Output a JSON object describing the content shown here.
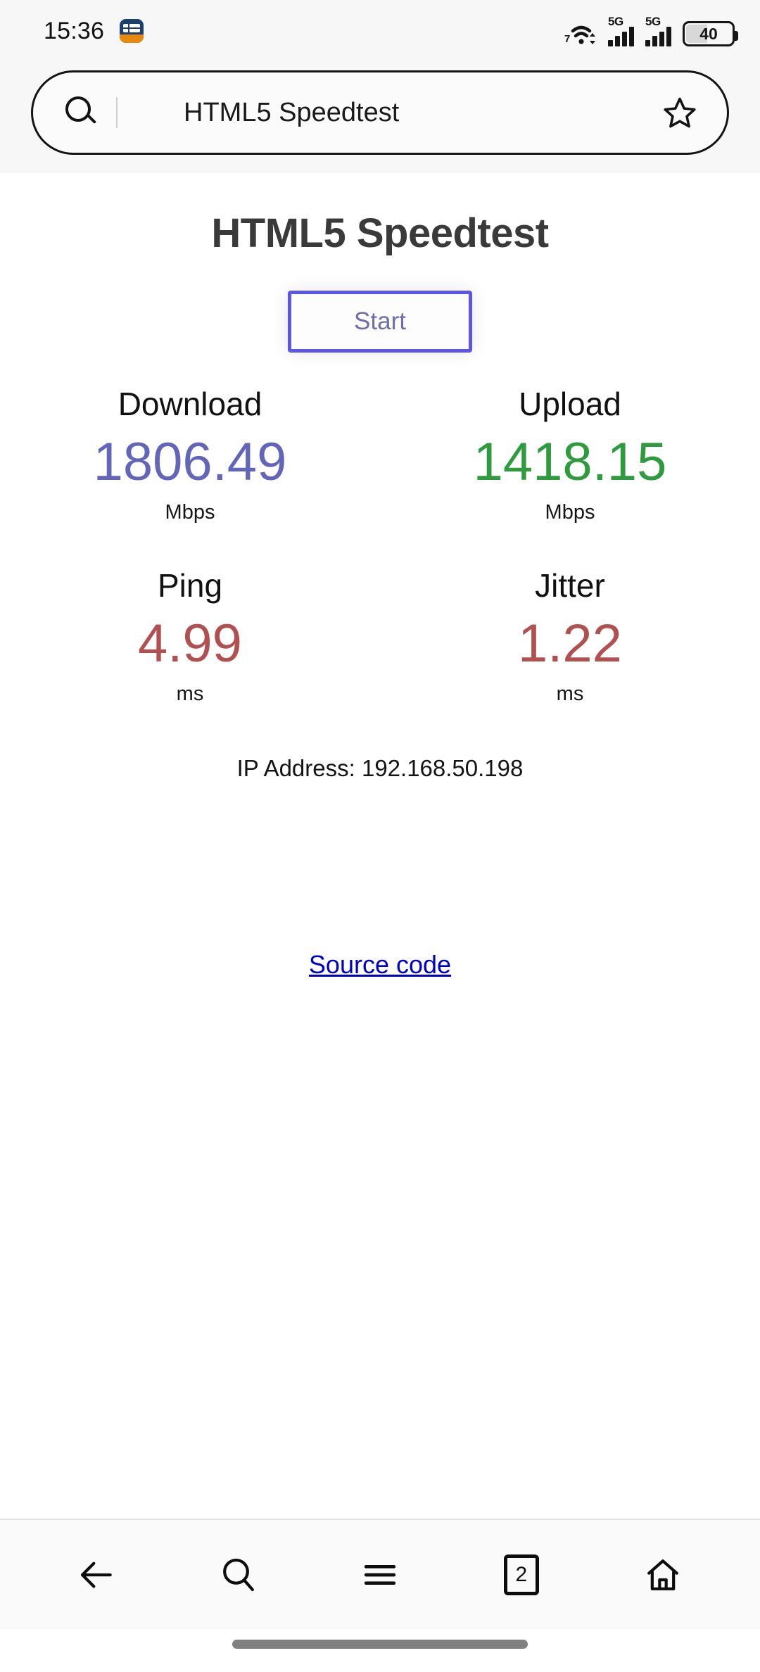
{
  "statusbar": {
    "time": "15:36",
    "app_icon": "calendar-app-icon",
    "wifi_icon": "wifi-7-icon",
    "wifi_generation": "7",
    "signal1": {
      "icon": "signal-5g-icon",
      "label": "5G"
    },
    "signal2": {
      "icon": "signal-5g-icon",
      "label": "5G"
    },
    "battery": {
      "icon": "battery-icon",
      "level": "40"
    }
  },
  "browser": {
    "search_icon": "search-icon",
    "security_icon": "shield-warning-icon",
    "url_text": "HTML5 Speedtest",
    "bookmark_icon": "star-outline-icon"
  },
  "page": {
    "title": "HTML5 Speedtest",
    "start_button": "Start",
    "metrics": [
      {
        "label": "Download",
        "value": "1806.49",
        "unit": "Mbps",
        "color": "#6366b8"
      },
      {
        "label": "Upload",
        "value": "1418.15",
        "unit": "Mbps",
        "color": "#2e9b3f"
      },
      {
        "label": "Ping",
        "value": "4.99",
        "unit": "ms",
        "color": "#b05050"
      },
      {
        "label": "Jitter",
        "value": "1.22",
        "unit": "ms",
        "color": "#b05050"
      }
    ],
    "ip_address": "IP Address: 192.168.50.198",
    "source_code_link": "Source code"
  },
  "navbar": {
    "back_icon": "back-arrow-icon",
    "search_icon": "search-icon",
    "menu_icon": "hamburger-menu-icon",
    "tabs_icon": "tab-switcher-icon",
    "tab_count": "2",
    "home_icon": "home-icon"
  },
  "colors": {
    "accent_border": "#5b56e8",
    "link": "#0000cc",
    "header_bg": "#f7f7f7"
  }
}
